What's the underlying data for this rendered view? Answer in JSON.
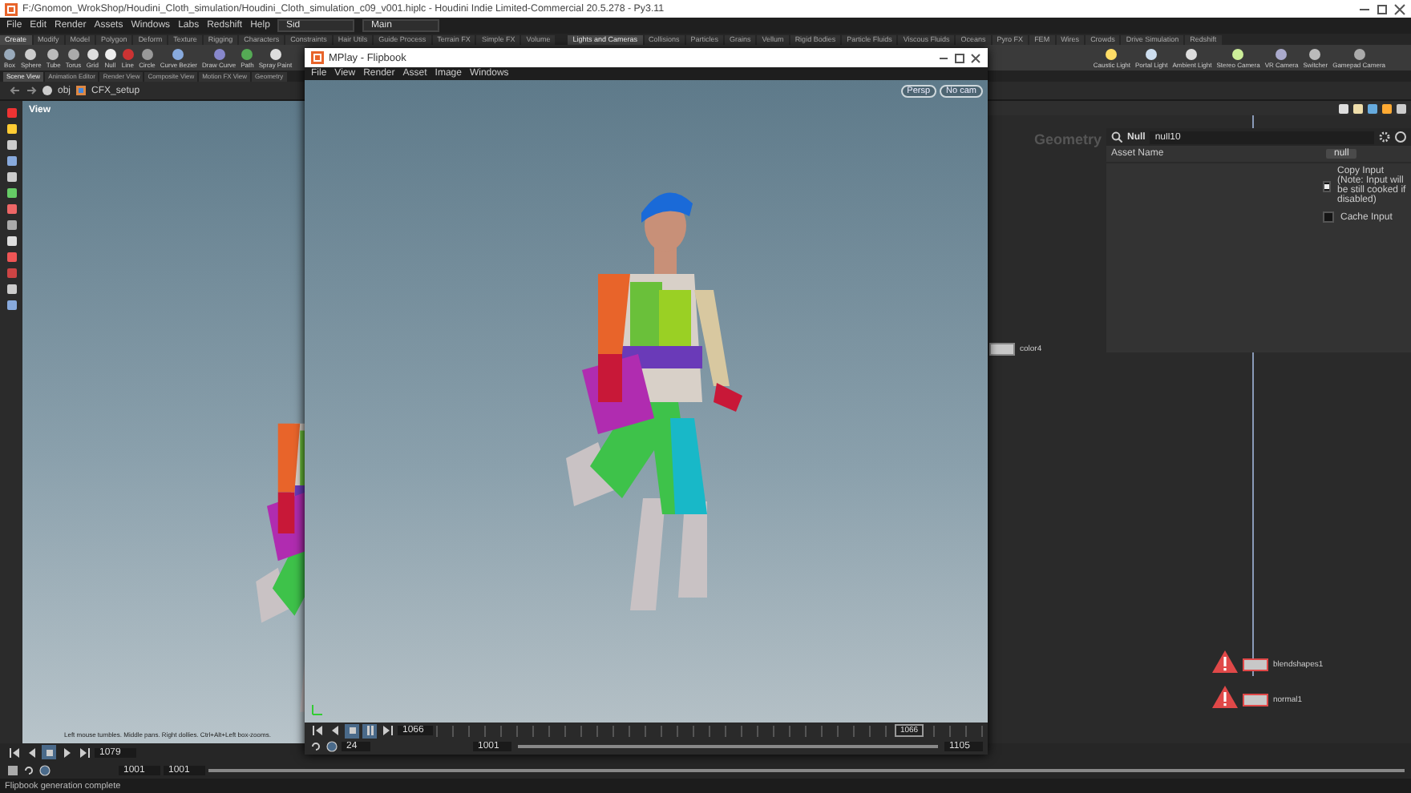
{
  "window": {
    "title": "F:/Gnomon_WrokShop/Houdini_Cloth_simulation/Houdini_Cloth_simulation_c09_v001.hiplc - Houdini Indie Limited-Commercial 20.5.278 - Py3.11"
  },
  "menu": [
    "File",
    "Edit",
    "Render",
    "Assets",
    "Windows",
    "Labs",
    "Redshift",
    "Help"
  ],
  "desktop": {
    "value": "Sid"
  },
  "context": {
    "value": "Main"
  },
  "shelf_left": {
    "tabs": [
      {
        "label": "Create",
        "selected": true
      },
      {
        "label": "Modify",
        "selected": false
      },
      {
        "label": "Model",
        "selected": false
      },
      {
        "label": "Polygon",
        "selected": false
      },
      {
        "label": "Deform",
        "selected": false
      },
      {
        "label": "Texture",
        "selected": false
      },
      {
        "label": "Rigging",
        "selected": false
      },
      {
        "label": "Characters",
        "selected": false
      },
      {
        "label": "Constraints",
        "selected": false
      },
      {
        "label": "Hair Utils",
        "selected": false
      },
      {
        "label": "Guide Process",
        "selected": false
      },
      {
        "label": "Terrain FX",
        "selected": false
      },
      {
        "label": "Simple FX",
        "selected": false
      },
      {
        "label": "Volume",
        "selected": false
      }
    ],
    "tools": [
      "Box",
      "Sphere",
      "Tube",
      "Torus",
      "Grid",
      "Null",
      "Line",
      "Circle",
      "Curve Bezier",
      "Draw Curve",
      "Path",
      "Spray Paint"
    ]
  },
  "shelf_right": {
    "tabs": [
      {
        "label": "Lights and Cameras",
        "selected": true
      },
      {
        "label": "Collisions",
        "selected": false
      },
      {
        "label": "Particles",
        "selected": false
      },
      {
        "label": "Grains",
        "selected": false
      },
      {
        "label": "Vellum",
        "selected": false
      },
      {
        "label": "Rigid Bodies",
        "selected": false
      },
      {
        "label": "Particle Fluids",
        "selected": false
      },
      {
        "label": "Viscous Fluids",
        "selected": false
      },
      {
        "label": "Oceans",
        "selected": false
      },
      {
        "label": "Pyro FX",
        "selected": false
      },
      {
        "label": "FEM",
        "selected": false
      },
      {
        "label": "Wires",
        "selected": false
      },
      {
        "label": "Crowds",
        "selected": false
      },
      {
        "label": "Drive Simulation",
        "selected": false
      },
      {
        "label": "Redshift",
        "selected": false
      }
    ],
    "tools": [
      "Caustic Light",
      "Portal Light",
      "Ambient Light",
      "Stereo Camera",
      "VR Camera",
      "Switcher",
      "Gamepad Camera"
    ]
  },
  "pane_tabs": [
    {
      "label": "Scene View",
      "selected": true
    },
    {
      "label": "Animation Editor",
      "selected": false
    },
    {
      "label": "Render View",
      "selected": false
    },
    {
      "label": "Composite View",
      "selected": false
    },
    {
      "label": "Motion FX View",
      "selected": false
    },
    {
      "label": "Geometry",
      "selected": false
    }
  ],
  "path": [
    "obj",
    "CFX_setup"
  ],
  "scene_view": {
    "label": "View",
    "hint": "Left mouse tumbles. Middle pans. Right dollies. Ctrl+Alt+Left box-zooms."
  },
  "flipbook": {
    "title": "MPlay - Flipbook",
    "menu": [
      "File",
      "View",
      "Render",
      "Asset",
      "Image",
      "Windows"
    ],
    "buttons": [
      "Persp",
      "No cam"
    ],
    "frame": "1066",
    "fps": "24",
    "start": "1001",
    "end": "1105",
    "level": 1,
    "marker": "1066"
  },
  "network": {
    "label": "Geometry",
    "nodes": [
      {
        "name": "color4",
        "warning": false
      },
      {
        "name": "blendshapes1",
        "warning": true
      },
      {
        "name": "normal1",
        "warning": true
      }
    ]
  },
  "parameters": {
    "type": "Null",
    "name": "null10",
    "fields": [
      {
        "label": "Asset Name",
        "value": "null"
      }
    ],
    "toggles": [
      {
        "label": "Copy Input (Note: Input will be still cooked if disabled)",
        "checked": true
      },
      {
        "label": "Cache Input",
        "checked": false
      }
    ]
  },
  "playbar": {
    "frame": "1079",
    "start": "1001",
    "end": "1001",
    "level": 1
  },
  "status_bar": "Flipbook generation complete"
}
